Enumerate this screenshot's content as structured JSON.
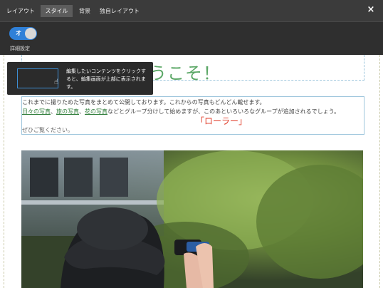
{
  "topbar": {
    "tabs": [
      {
        "label": "レイアウト",
        "active": false
      },
      {
        "label": "スタイル",
        "active": true
      },
      {
        "label": "背景",
        "active": false
      },
      {
        "label": "独自レイアウト",
        "active": false
      }
    ],
    "close_label": "×"
  },
  "settings": {
    "toggle_label": "オ",
    "toggle_state": "on",
    "detail_label": "詳細設定"
  },
  "content": {
    "page_title": "ギャラリーへようこそ！",
    "tooltip_text": "編集したいコンテンツをクリックすると、編集画面が上部に表示されます。",
    "paragraph1": "これまでに撮りためた写真をまとめて公開しております。これからの写真もどんどん載せます。",
    "links": [
      "日々の写真",
      "旅の写真",
      "花の写真"
    ],
    "paragraph2_rest": "などとグループ分けして始めますが、このあといろいろなグループが追加されるでしょう。",
    "paragraph3": "ぜひご覧ください。",
    "annotation": "「ローラー」",
    "photo_icon": "photo-image"
  },
  "colors": {
    "topbar_bg": "#3b3b3b",
    "settings_bg": "#2f2f2f",
    "toggle_on": "#2f80d8",
    "title_green": "#4a9e56",
    "link_green": "#2f7d3a",
    "annotation_red": "#e03c28",
    "edit_border": "#9ec6dd"
  }
}
